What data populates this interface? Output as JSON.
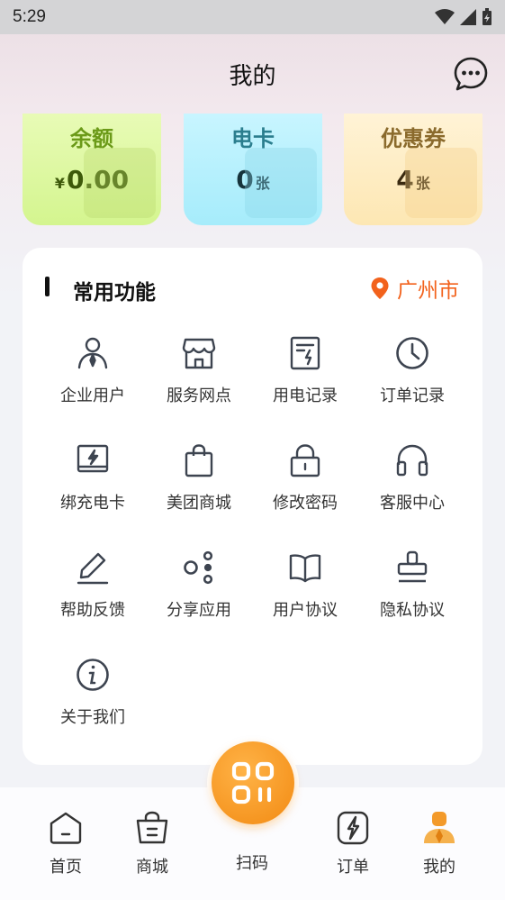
{
  "status": {
    "time": "5:29"
  },
  "header": {
    "title": "我的"
  },
  "cards": {
    "balance": {
      "title": "余额",
      "prefix": "¥",
      "value": "0.00"
    },
    "ecard": {
      "title": "电卡",
      "value": "0",
      "suffix": "张"
    },
    "coupon": {
      "title": "优惠券",
      "value": "4",
      "suffix": "张"
    }
  },
  "panel": {
    "title": "常用功能",
    "location": "广州市",
    "items": [
      {
        "label": "企业用户",
        "icon": "enterprise-user-icon"
      },
      {
        "label": "服务网点",
        "icon": "store-icon"
      },
      {
        "label": "用电记录",
        "icon": "power-record-icon"
      },
      {
        "label": "订单记录",
        "icon": "clock-icon"
      },
      {
        "label": "绑充电卡",
        "icon": "charge-card-icon"
      },
      {
        "label": "美团商城",
        "icon": "shopping-bag-icon"
      },
      {
        "label": "修改密码",
        "icon": "lock-icon"
      },
      {
        "label": "客服中心",
        "icon": "headset-icon"
      },
      {
        "label": "帮助反馈",
        "icon": "edit-icon"
      },
      {
        "label": "分享应用",
        "icon": "share-icon"
      },
      {
        "label": "用户协议",
        "icon": "book-icon"
      },
      {
        "label": "隐私协议",
        "icon": "stamp-icon"
      },
      {
        "label": "关于我们",
        "icon": "info-icon"
      }
    ]
  },
  "tabbar": {
    "home": "首页",
    "mall": "商城",
    "scan": "扫码",
    "orders": "订单",
    "mine": "我的"
  },
  "colors": {
    "accent": "#f2621c",
    "scan": "#f5951f",
    "active_tab": "#f39a2a"
  }
}
